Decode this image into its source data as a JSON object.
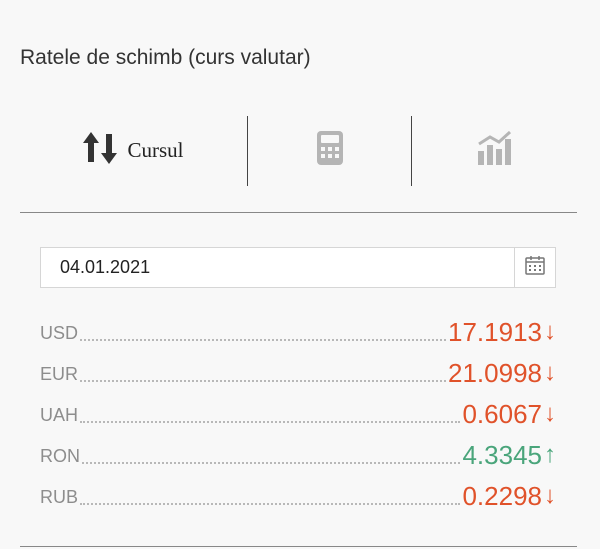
{
  "widget": {
    "title": "Ratele de schimb (curs valutar)"
  },
  "tabs": [
    {
      "label": "Cursul",
      "icon": "exchange-arrows-icon",
      "active": true
    },
    {
      "label": "",
      "icon": "calculator-icon",
      "active": false
    },
    {
      "label": "",
      "icon": "bar-chart-icon",
      "active": false
    }
  ],
  "date_picker": {
    "value": "04.01.2021",
    "icon": "calendar-icon"
  },
  "rates": [
    {
      "code": "USD",
      "value": "17.1913",
      "trend": "down",
      "arrow": "↓"
    },
    {
      "code": "EUR",
      "value": "21.0998",
      "trend": "down",
      "arrow": "↓"
    },
    {
      "code": "UAH",
      "value": "0.6067",
      "trend": "down",
      "arrow": "↓"
    },
    {
      "code": "RON",
      "value": "4.3345",
      "trend": "up",
      "arrow": "↑"
    },
    {
      "code": "RUB",
      "value": "0.2298",
      "trend": "down",
      "arrow": "↓"
    }
  ],
  "colors": {
    "down": "#e0522a",
    "up": "#4aa57b",
    "icon_gray": "#b5b5b5"
  }
}
